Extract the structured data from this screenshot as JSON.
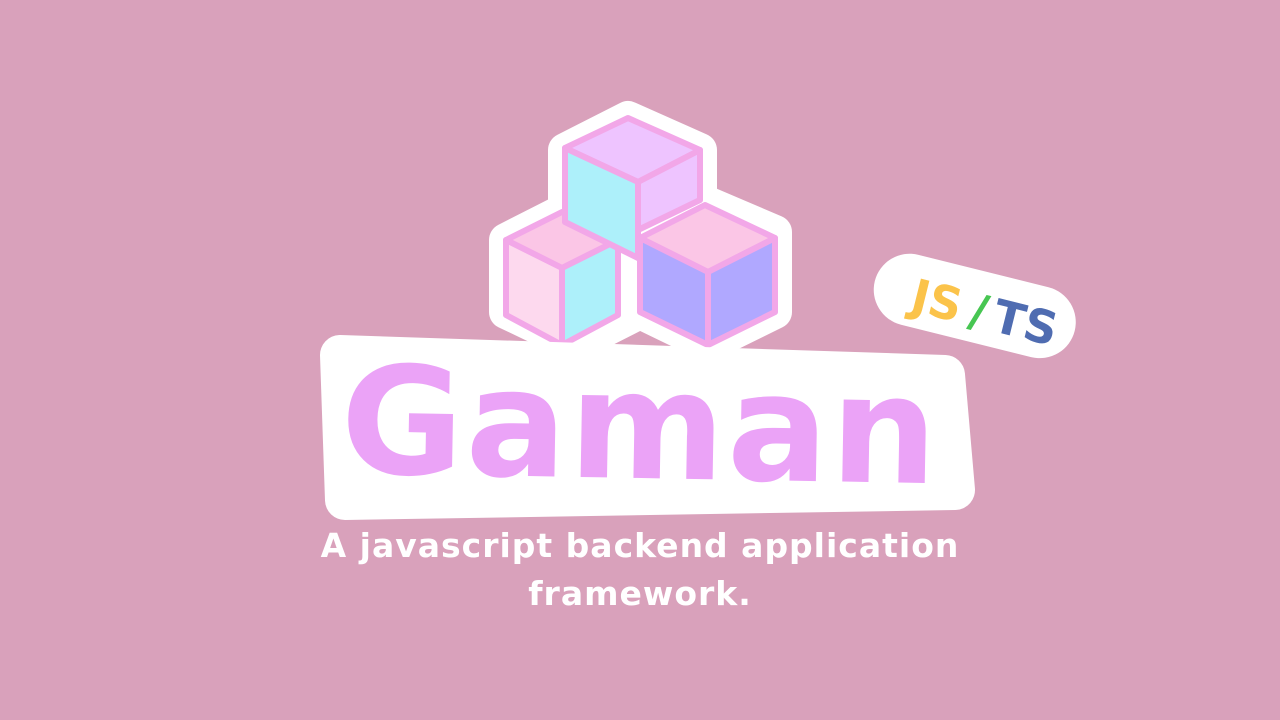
{
  "brand": {
    "name": "Gaman",
    "badge_js": "JS",
    "badge_sep": "/",
    "badge_ts": "TS",
    "tagline": "A javascript backend application framework."
  },
  "colors": {
    "background": "#d9a1bb",
    "wordmark": "#eba3f7",
    "outline": "#ffffff",
    "cube_top_lilac": "#eec4ff",
    "cube_side_cyan": "#adf0fa",
    "cube_pink": "#fbc6e6",
    "cube_pink_light": "#fdd9ee",
    "cube_violet": "#b0a8ff",
    "cube_edge": "#f2a7e8",
    "js_badge": "#fbc34a",
    "slash": "#47c652",
    "ts_badge": "#4f6cb1"
  }
}
